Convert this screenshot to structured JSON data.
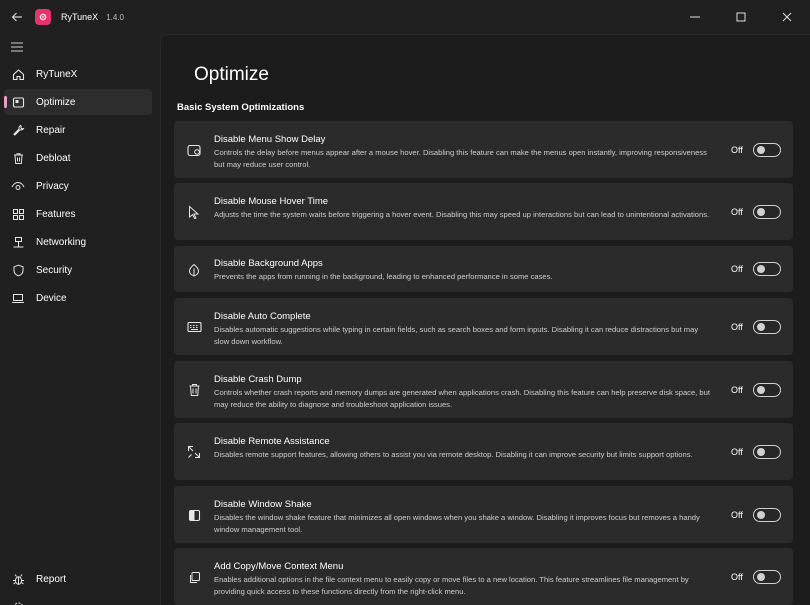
{
  "titlebar": {
    "app_name": "RyTuneX",
    "version": "1.4.0",
    "back_icon": "back-arrow-icon",
    "controls": [
      "minimize-icon",
      "maximize-icon",
      "close-icon"
    ]
  },
  "sidebar": {
    "items": [
      {
        "label": "RyTuneX",
        "icon": "home-icon"
      },
      {
        "label": "Optimize",
        "icon": "optimize-icon",
        "active": true
      },
      {
        "label": "Repair",
        "icon": "wrench-icon"
      },
      {
        "label": "Debloat",
        "icon": "trash-icon"
      },
      {
        "label": "Privacy",
        "icon": "eye-icon"
      },
      {
        "label": "Features",
        "icon": "grid-icon"
      },
      {
        "label": "Networking",
        "icon": "network-icon"
      },
      {
        "label": "Security",
        "icon": "shield-icon"
      },
      {
        "label": "Device",
        "icon": "laptop-icon"
      }
    ],
    "bottom": {
      "report_label": "Report",
      "report_icon": "bug-icon"
    }
  },
  "main": {
    "title": "Optimize",
    "section_title": "Basic System Optimizations",
    "settings": [
      {
        "title": "Disable Menu Show Delay",
        "description": "Controls the delay before menus appear after a mouse hover. Disabling this feature can make the menus open instantly, improving responsiveness but may reduce user control.",
        "state": "Off",
        "icon": "menu-delay-icon"
      },
      {
        "title": "Disable Mouse Hover Time",
        "description": "Adjusts the time the system waits before triggering a hover event. Disabling this may speed up interactions but can lead to unintentional activations.",
        "state": "Off",
        "icon": "cursor-icon"
      },
      {
        "title": "Disable Background Apps",
        "description": "Prevents the apps from running in the background, leading to enhanced performance in some cases.",
        "state": "Off",
        "icon": "leaf-icon"
      },
      {
        "title": "Disable Auto Complete",
        "description": "Disables automatic suggestions while typing in certain fields, such as search boxes and form inputs. Disabling it can reduce distractions but may slow down workflow.",
        "state": "Off",
        "icon": "keyboard-icon"
      },
      {
        "title": "Disable Crash Dump",
        "description": "Controls whether crash reports and memory dumps are generated when applications crash. Disabling this feature can help preserve disk space, but may reduce the ability to diagnose and troubleshoot application issues.",
        "state": "Off",
        "icon": "trash-icon"
      },
      {
        "title": "Disable Remote Assistance",
        "description": "Disables remote support features, allowing others to assist you via remote desktop. Disabling it can improve security but limits support options.",
        "state": "Off",
        "icon": "remote-icon"
      },
      {
        "title": "Disable Window Shake",
        "description": "Disables the window shake feature that minimizes all open windows when you shake a window. Disabling it improves focus but removes a handy window management tool.",
        "state": "Off",
        "icon": "window-icon"
      },
      {
        "title": "Add Copy/Move Context Menu",
        "description": "Enables additional options in the file context menu to easily copy or move files to a new location. This feature streamlines file management by providing quick access to these functions directly from the right-click menu.",
        "state": "Off",
        "icon": "copy-icon"
      }
    ]
  }
}
